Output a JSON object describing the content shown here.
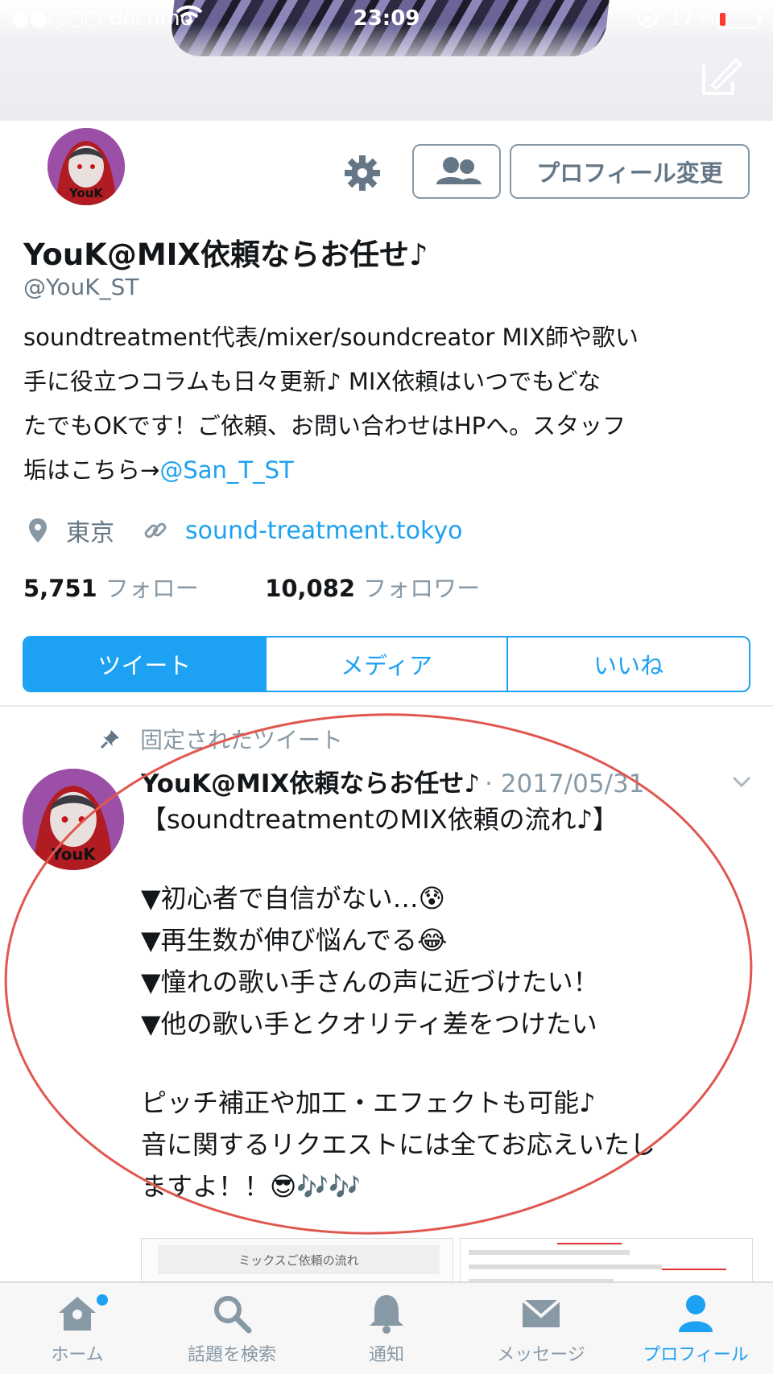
{
  "status_bar": {
    "carrier": "●●○○○ docomo",
    "time": "23:09",
    "battery": "17%",
    "battery_level": 0.17,
    "battery_color": "#ff3b30"
  },
  "profile": {
    "display_name": "YouK@MIX依頼ならお任せ♪",
    "handle": "@YouK_ST",
    "avatar_caption": "YouK",
    "edit_button": "プロフィール変更",
    "bio_lines": [
      "soundtreatment代表/mixer/soundcreator MIX師や歌い",
      "手に役立つコラムも日々更新♪ MIX依頼はいつでもどな",
      "たでもOKです！ご依頼、お問い合わせはHPへ。スタッフ",
      "垢はこちら→"
    ],
    "bio_mention": "@San_T_ST",
    "location": "東京",
    "website": "sound-treatment.tokyo",
    "following_count": "5,751",
    "following_label": "フォロー",
    "followers_count": "10,082",
    "followers_label": "フォロワー"
  },
  "tabs": [
    {
      "label": "ツイート",
      "active": true
    },
    {
      "label": "メディア",
      "active": false
    },
    {
      "label": "いいね",
      "active": false
    }
  ],
  "pinned_tweet": {
    "pin_label": "固定されたツイート",
    "author": "YouK@MIX依頼ならお任せ♪",
    "date": "· 2017/05/31",
    "lines": [
      "【soundtreatmentのMIX依頼の流れ♪】",
      "",
      "▼初心者で自信がない…😰",
      "▼再生数が伸び悩んでる😂",
      "▼憧れの歌い手さんの声に近づけたい！",
      "▼他の歌い手とクオリティ差をつけたい",
      "",
      "ピッチ補正や加工・エフェクトも可能♪",
      "音に関するリクエストには全てお応えいたし",
      "ますよ！！😎🎶🎶"
    ],
    "preview_title": "ミックスご依頼の流れ"
  },
  "bottom_nav": [
    {
      "label": "ホーム",
      "icon": "home-icon",
      "active": false,
      "badge": true
    },
    {
      "label": "話題を検索",
      "icon": "search-icon",
      "active": false,
      "badge": false
    },
    {
      "label": "通知",
      "icon": "bell-icon",
      "active": false,
      "badge": false
    },
    {
      "label": "メッセージ",
      "icon": "envelope-icon",
      "active": false,
      "badge": false
    },
    {
      "label": "プロフィール",
      "icon": "person-icon",
      "active": true,
      "badge": false
    }
  ],
  "colors": {
    "accent": "#1da1f2",
    "annotation_circle": "#e0574f",
    "avatar_bg": "#9b4fa6"
  }
}
